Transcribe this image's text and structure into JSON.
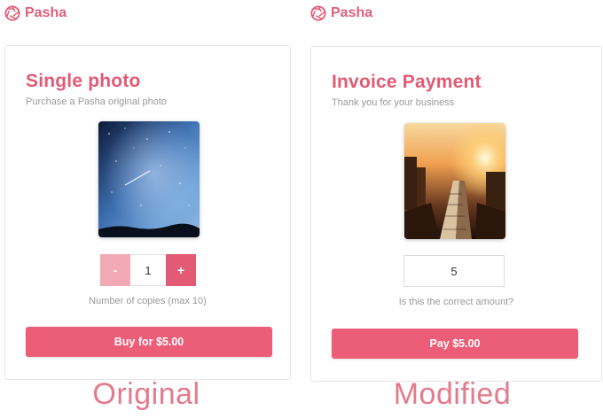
{
  "brand_name": "Pasha",
  "colors": {
    "accent": "#e25a74",
    "accent_light": "#f3a8b6",
    "button": "#ec5e78",
    "caption": "#e47a8c"
  },
  "left": {
    "title": "Single photo",
    "subtitle": "Purchase a Pasha original photo",
    "photo_icon": "starry-night-photo",
    "stepper": {
      "minus_label": "-",
      "value": "1",
      "plus_label": "+"
    },
    "hint": "Number of copies (max 10)",
    "button_label": "Buy for $5.00",
    "caption": "Original"
  },
  "right": {
    "title": "Invoice Payment",
    "subtitle": "Thank you for your business",
    "photo_icon": "sunset-train-photo",
    "amount_value": "5",
    "hint": "Is this the correct amount?",
    "button_label": "Pay $5.00",
    "caption": "Modified"
  }
}
